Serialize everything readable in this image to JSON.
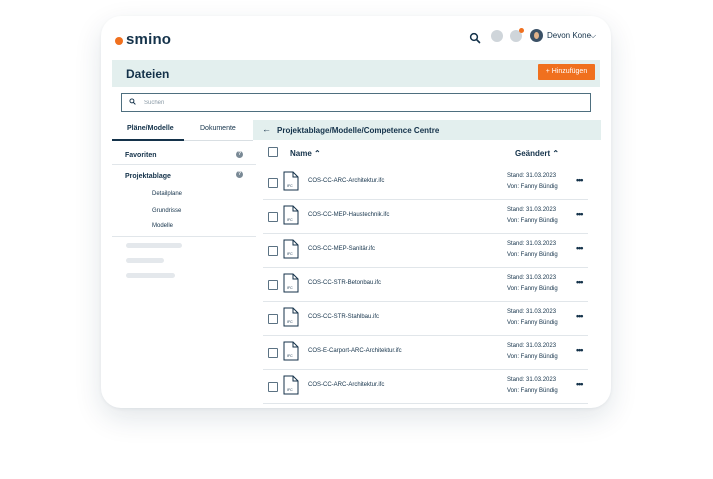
{
  "brand": {
    "name": "smino",
    "accent": "#f0701e",
    "primary": "#14324a",
    "header_bg": "#e3efee"
  },
  "topbar": {
    "search_icon": "search-icon",
    "user_name": "Devon Kone",
    "chevron": "⌵"
  },
  "page": {
    "title": "Dateien",
    "add_button": "+ Hinzufügen"
  },
  "search": {
    "placeholder": "Suchen"
  },
  "tabs": [
    {
      "label": "Pläne/Modelle",
      "active": true
    },
    {
      "label": "Dokumente",
      "active": false
    }
  ],
  "sidebar": {
    "favorites": "Favoriten",
    "projektablage": "Projektablage",
    "help": "?",
    "children": [
      "Detailplane",
      "Grundrisse",
      "Modelle"
    ]
  },
  "breadcrumb": {
    "back": "←",
    "path": "Projektablage/Modelle/Competence Centre"
  },
  "table": {
    "columns": {
      "name": "Name ⌃",
      "changed": "Geändert ⌃"
    },
    "file_type": "IFC",
    "more": "•••",
    "rows": [
      {
        "name": "COS-CC-ARC-Architektur.ifc",
        "stand": "Stand: 31.03.2023",
        "by": "Von: Fanny Bündig"
      },
      {
        "name": "COS-CC-MEP-Haustechnik.ifc",
        "stand": "Stand: 31.03.2023",
        "by": "Von: Fanny Bündig"
      },
      {
        "name": "COS-CC-MEP-Sanitär.ifc",
        "stand": "Stand: 31.03.2023",
        "by": "Von: Fanny Bündig"
      },
      {
        "name": "COS-CC-STR-Betonbau.ifc",
        "stand": "Stand: 31.03.2023",
        "by": "Von: Fanny Bündig"
      },
      {
        "name": "COS-CC-STR-Stahlbau.ifc",
        "stand": "Stand: 31.03.2023",
        "by": "Von: Fanny Bündig"
      },
      {
        "name": "COS-E-Carport-ARC-Architektur.ifc",
        "stand": "Stand: 31.03.2023",
        "by": "Von: Fanny Bündig"
      },
      {
        "name": "COS-CC-ARC-Architektur.ifc",
        "stand": "Stand: 31.03.2023",
        "by": "Von: Fanny Bündig"
      }
    ]
  }
}
